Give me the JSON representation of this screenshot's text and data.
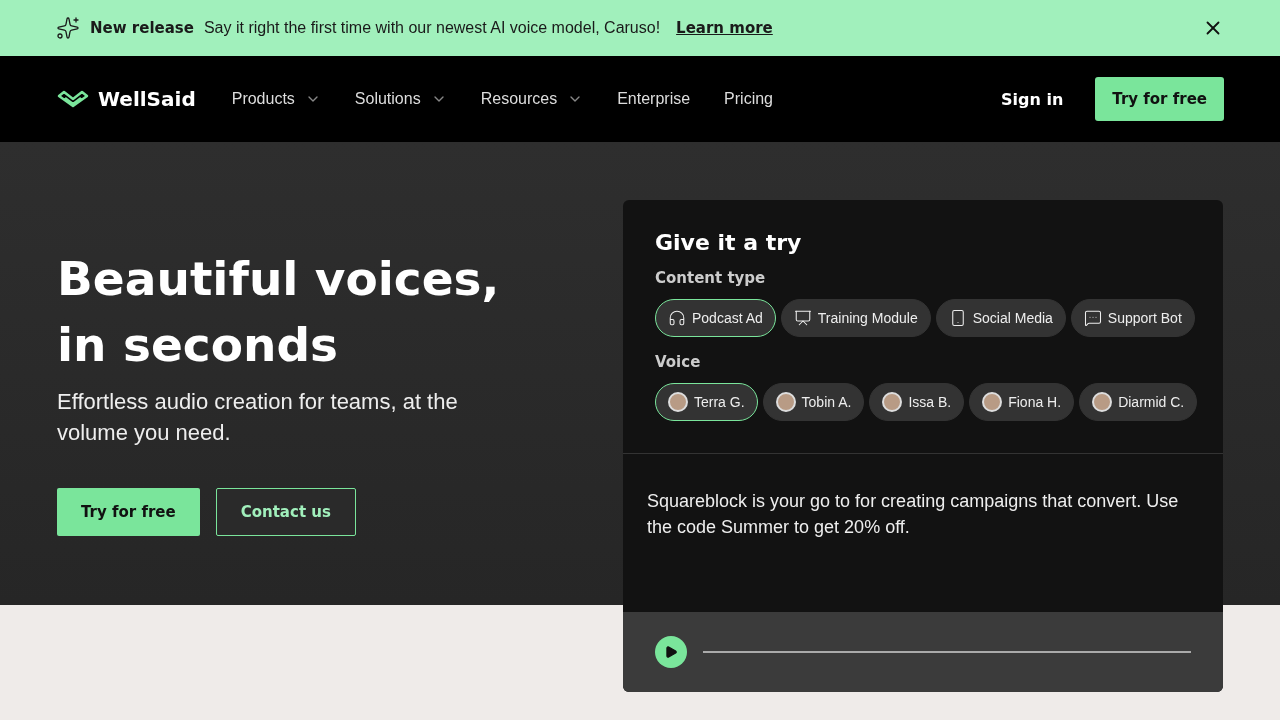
{
  "banner": {
    "label": "New release",
    "text": "Say it right the first time with our newest AI voice model, Caruso!",
    "link": "Learn more"
  },
  "nav": {
    "logo": "WellSaid",
    "items": [
      {
        "label": "Products",
        "dropdown": true
      },
      {
        "label": "Solutions",
        "dropdown": true
      },
      {
        "label": "Resources",
        "dropdown": true
      },
      {
        "label": "Enterprise",
        "dropdown": false
      },
      {
        "label": "Pricing",
        "dropdown": false
      }
    ],
    "sign_in": "Sign in",
    "cta": "Try for free"
  },
  "hero": {
    "title_lines": [
      "Beautiful voices,",
      "in seconds"
    ],
    "subtitle": "Effortless audio creation for teams, at the volume you need.",
    "primary": "Try for free",
    "secondary": "Contact us"
  },
  "demo": {
    "title": "Give it a try",
    "content_label": "Content type",
    "content_types": [
      {
        "label": "Podcast Ad",
        "kind": "headphones",
        "selected": true
      },
      {
        "label": "Training Module",
        "kind": "presentation",
        "selected": false
      },
      {
        "label": "Social Media",
        "kind": "phone",
        "selected": false
      },
      {
        "label": "Support Bot",
        "kind": "chat",
        "selected": false
      }
    ],
    "voice_label": "Voice",
    "voices": [
      {
        "label": "Terra G.",
        "selected": true
      },
      {
        "label": "Tobin A.",
        "selected": false
      },
      {
        "label": "Issa B.",
        "selected": false
      },
      {
        "label": "Fiona H.",
        "selected": false
      },
      {
        "label": "Diarmid C.",
        "selected": false
      }
    ],
    "script": "Squareblock is your go to for creating campaigns that convert. Use the code Summer to get 20% off."
  }
}
